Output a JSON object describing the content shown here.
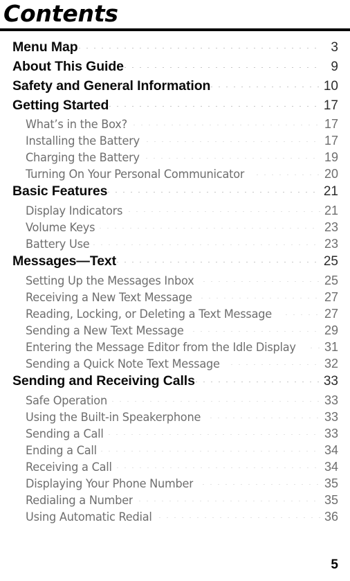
{
  "document": {
    "title": "Contents",
    "folio": "5"
  },
  "entries": [
    {
      "label": "Menu Map",
      "page": "3",
      "level": 1
    },
    {
      "label": "About This Guide",
      "page": "9",
      "level": 1
    },
    {
      "label": "Safety and General Information",
      "page": "10",
      "level": 1
    },
    {
      "label": "Getting Started",
      "page": "17",
      "level": 1
    },
    {
      "label": "What’s in the Box?",
      "page": "17",
      "level": 2
    },
    {
      "label": "Installing the Battery",
      "page": "17",
      "level": 2
    },
    {
      "label": "Charging the Battery",
      "page": "19",
      "level": 2
    },
    {
      "label": "Turning On Your Personal Communicator",
      "page": "20",
      "level": 2
    },
    {
      "label": "Basic Features",
      "page": "21",
      "level": 1
    },
    {
      "label": "Display Indicators",
      "page": "21",
      "level": 2
    },
    {
      "label": "Volume Keys",
      "page": "23",
      "level": 2
    },
    {
      "label": "Battery Use",
      "page": "23",
      "level": 2
    },
    {
      "label": "Messages—Text",
      "page": "25",
      "level": 1
    },
    {
      "label": "Setting Up the Messages Inbox",
      "page": "25",
      "level": 2
    },
    {
      "label": "Receiving a New Text Message",
      "page": "27",
      "level": 2
    },
    {
      "label": "Reading, Locking, or Deleting a Text Message",
      "page": "27",
      "level": 2
    },
    {
      "label": "Sending a New Text Message",
      "page": "29",
      "level": 2
    },
    {
      "label": "Entering the Message Editor from the Idle Display",
      "page": "31",
      "level": 2
    },
    {
      "label": "Sending a Quick Note Text Message",
      "page": "32",
      "level": 2
    },
    {
      "label": "Sending and Receiving Calls",
      "page": "33",
      "level": 1
    },
    {
      "label": "Safe Operation",
      "page": "33",
      "level": 2
    },
    {
      "label": "Using the Built-in Speakerphone",
      "page": "33",
      "level": 2
    },
    {
      "label": "Sending a Call",
      "page": "33",
      "level": 2
    },
    {
      "label": "Ending a Call",
      "page": "34",
      "level": 2
    },
    {
      "label": "Receiving a Call",
      "page": "34",
      "level": 2
    },
    {
      "label": "Displaying Your Phone Number",
      "page": "35",
      "level": 2
    },
    {
      "label": "Redialing a Number",
      "page": "35",
      "level": 2
    },
    {
      "label": "Using Automatic Redial",
      "page": "36",
      "level": 2
    }
  ]
}
